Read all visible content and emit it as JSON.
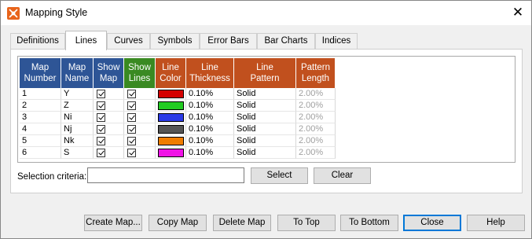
{
  "window": {
    "title": "Mapping Style",
    "close_glyph": "✕"
  },
  "tabs": [
    {
      "label": "Definitions"
    },
    {
      "label": "Lines",
      "active": true
    },
    {
      "label": "Curves"
    },
    {
      "label": "Symbols"
    },
    {
      "label": "Error Bars"
    },
    {
      "label": "Bar Charts"
    },
    {
      "label": "Indices"
    }
  ],
  "grid": {
    "columns": [
      {
        "label": "Map\nNumber",
        "color": "#2e5596"
      },
      {
        "label": "Map\nName",
        "color": "#2e5596"
      },
      {
        "label": "Show\nMap",
        "color": "#2e5596"
      },
      {
        "label": "Show\nLines",
        "color": "#3a8a22"
      },
      {
        "label": "Line\nColor",
        "color": "#c1501e"
      },
      {
        "label": "Line\nThickness",
        "color": "#c1501e"
      },
      {
        "label": "Line\nPattern",
        "color": "#c1501e"
      },
      {
        "label": "Pattern\nLength",
        "color": "#c1501e"
      }
    ],
    "rows": [
      {
        "number": "1",
        "name": "Y",
        "show_map": true,
        "show_lines": true,
        "color": "#d40000",
        "thickness": "0.10%",
        "pattern": "Solid",
        "length": "2.00%"
      },
      {
        "number": "2",
        "name": "Z",
        "show_map": true,
        "show_lines": true,
        "color": "#22cc22",
        "thickness": "0.10%",
        "pattern": "Solid",
        "length": "2.00%"
      },
      {
        "number": "3",
        "name": "Ni",
        "show_map": true,
        "show_lines": true,
        "color": "#2a3ae6",
        "thickness": "0.10%",
        "pattern": "Solid",
        "length": "2.00%"
      },
      {
        "number": "4",
        "name": "Nj",
        "show_map": true,
        "show_lines": true,
        "color": "#555555",
        "thickness": "0.10%",
        "pattern": "Solid",
        "length": "2.00%"
      },
      {
        "number": "5",
        "name": "Nk",
        "show_map": true,
        "show_lines": true,
        "color": "#f07d00",
        "thickness": "0.10%",
        "pattern": "Solid",
        "length": "2.00%"
      },
      {
        "number": "6",
        "name": "S",
        "show_map": true,
        "show_lines": true,
        "color": "#f012e6",
        "thickness": "0.10%",
        "pattern": "Solid",
        "length": "2.00%"
      }
    ]
  },
  "selection": {
    "label": "Selection criteria:",
    "value": "",
    "select_label": "Select",
    "clear_label": "Clear"
  },
  "footer": {
    "create_map": "Create Map...",
    "copy_map": "Copy Map",
    "delete_map": "Delete Map",
    "to_top": "To Top",
    "to_bottom": "To Bottom",
    "close": "Close",
    "help": "Help"
  }
}
